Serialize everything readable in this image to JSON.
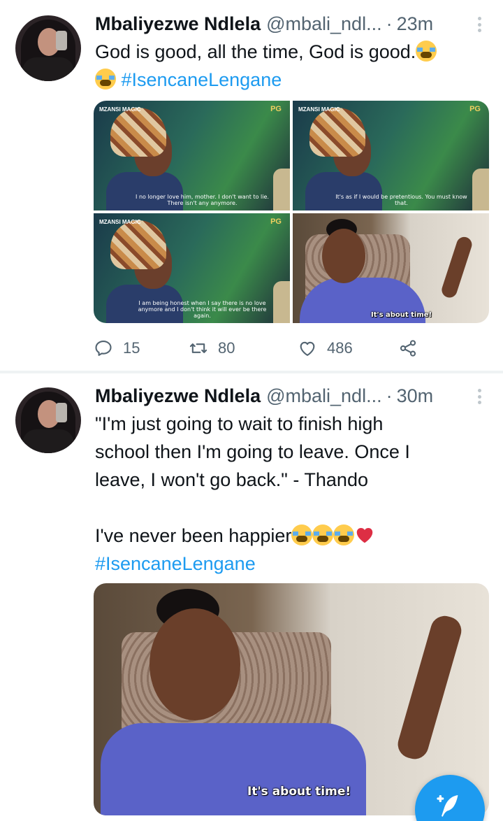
{
  "tweets": [
    {
      "author_name": "Mbaliyezwe Ndlela",
      "handle": "@mbali_ndl...",
      "separator": "·",
      "time": "23m",
      "text_line1": "God is good, all the time, God is good.",
      "hashtag": "#IsencaneLengane",
      "media": [
        {
          "logo": "MZANSI MAGIC",
          "rating": "PG",
          "subtitle": "I no longer love him, mother. I don't want to lie. There isn't any anymore."
        },
        {
          "logo": "MZANSI MAGIC",
          "rating": "PG",
          "subtitle": "It's as if I would be pretentious. You must know that."
        },
        {
          "logo": "MZANSI MAGIC",
          "rating": "PG",
          "subtitle": "I am being honest when I say there is no love anymore and I don't think it will ever be there again."
        },
        {
          "caption": "It's about time!"
        }
      ],
      "actions": {
        "replies": "15",
        "retweets": "80",
        "likes": "486"
      }
    },
    {
      "author_name": "Mbaliyezwe Ndlela",
      "handle": "@mbali_ndl...",
      "separator": "·",
      "time": "30m",
      "text_line1": "\"I'm just going to wait to finish high",
      "text_line2": "school then I'm going to leave. Once I",
      "text_line3": "leave, I won't go back.\" - Thando",
      "text_line4": "I've never been happier",
      "hashtag": "#IsencaneLengane",
      "media_caption": "It's about time!"
    }
  ],
  "icons": {
    "reply": "reply-icon",
    "retweet": "retweet-icon",
    "like": "heart-icon",
    "share": "share-icon",
    "compose": "compose-icon"
  },
  "colors": {
    "accent": "#1d9bf0",
    "muted": "#536471",
    "text": "#0f1419"
  }
}
